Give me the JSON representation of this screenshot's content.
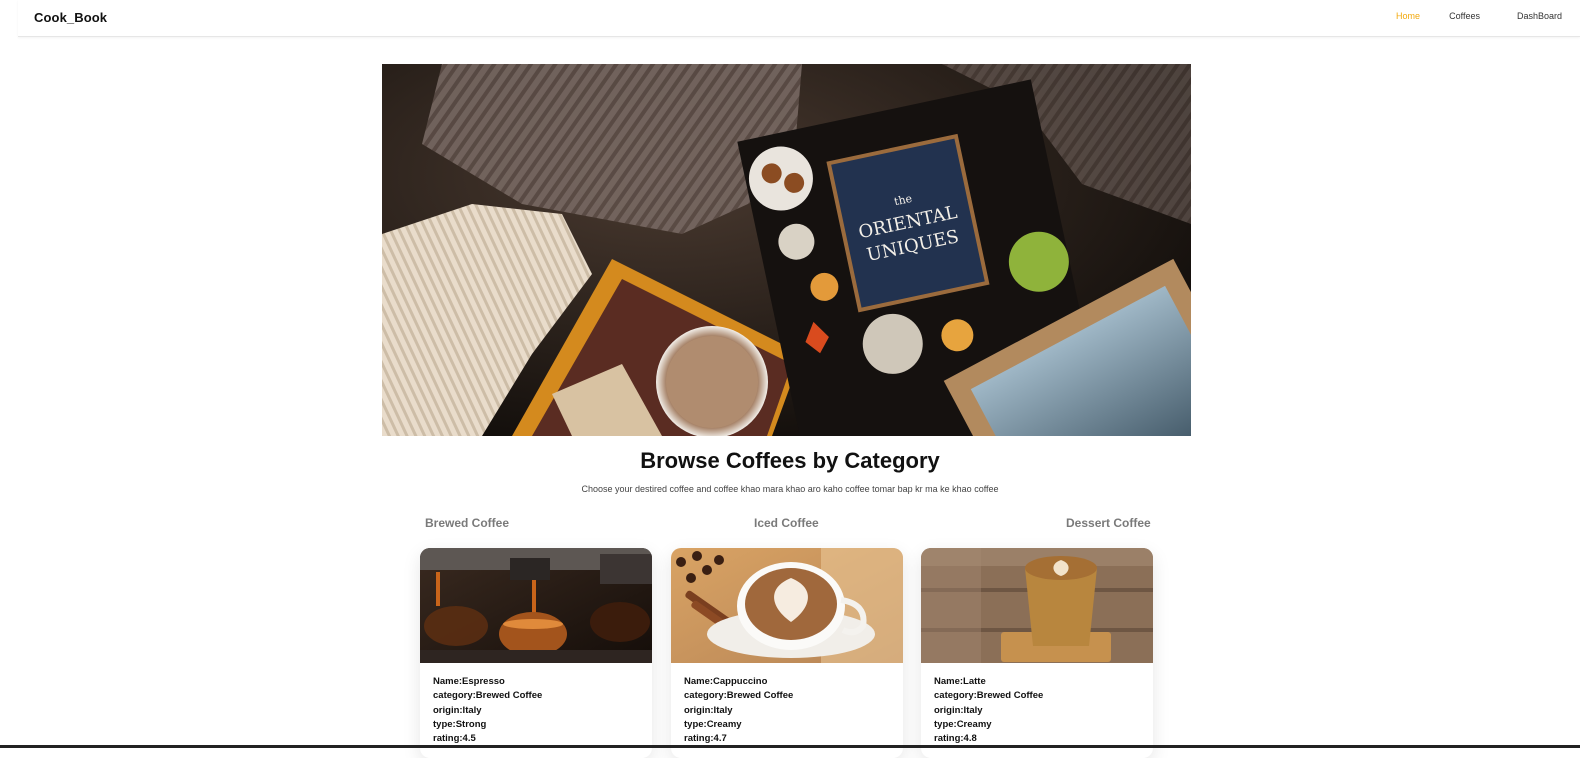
{
  "nav": {
    "brand": "Cook_Book",
    "links": [
      {
        "label": "Home",
        "active": true
      },
      {
        "label": "Coffees",
        "active": false
      },
      {
        "label": "DashBoard",
        "active": false
      }
    ]
  },
  "hero": {
    "cover_text": [
      "the",
      "ORIENTAL",
      "UNIQUES"
    ]
  },
  "browse": {
    "title": "Browse Coffees by Category",
    "subtitle": "Choose your destired coffee and coffee khao mara khao aro kaho coffee tomar bap kr ma ke khao coffee",
    "tabs": [
      "Brewed Coffee",
      "Iced Coffee",
      "Dessert Coffee"
    ]
  },
  "cards": [
    {
      "image": "espresso-machine-cups",
      "name": "Name:Espresso",
      "category": "category:Brewed Coffee",
      "origin": "origin:Italy",
      "type": "type:Strong",
      "rating": "rating:4.5"
    },
    {
      "image": "cappuccino-latte-art",
      "name": "Name:Cappuccino",
      "category": "category:Brewed Coffee",
      "origin": "origin:Italy",
      "type": "type:Creamy",
      "rating": "rating:4.7"
    },
    {
      "image": "latte-glass",
      "name": "Name:Latte",
      "category": "category:Brewed Coffee",
      "origin": "origin:Italy",
      "type": "type:Creamy",
      "rating": "rating:4.8"
    }
  ],
  "colors": {
    "accent": "#f2a90f",
    "text": "#111111",
    "tab_text": "#7a7a7a"
  }
}
